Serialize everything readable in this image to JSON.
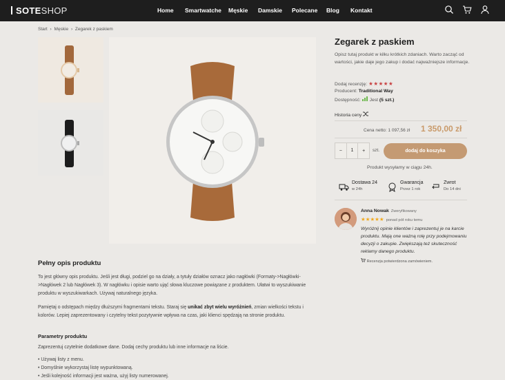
{
  "header": {
    "logo_bold": "SOTE",
    "logo_light": "SHOP",
    "nav": [
      "Home",
      "Smartwatche",
      "Męskie",
      "Damskie",
      "Polecane",
      "Blog",
      "Kontakt"
    ],
    "icons": [
      "search-icon",
      "cart-icon",
      "user-icon"
    ]
  },
  "breadcrumb": [
    "Start",
    "›",
    "Męskie",
    "›",
    "Zegarek z paskiem"
  ],
  "product": {
    "title": "Zegarek z paskiem",
    "description": "Opisz tutaj produkt w kilku krótkich zdaniach. Warto zacząć od wartości, jakie daje jego zakup i dodać najważniejsze informacje.",
    "review_label": "Dodaj recenzję:",
    "rating_stars": 5,
    "producer_label": "Producent:",
    "producer": "Traditional Way",
    "availability_label": "Dostępność:",
    "availability": "Jest",
    "stock": "(5 szt.)",
    "price_history": "Historia ceny",
    "net_price": "Cena netto: 1 097,56 zł",
    "price": "1 350,00 zł",
    "quantity": "1",
    "unit": "szt.",
    "add_to_cart": "dodaj do koszyka",
    "shipping_note": "Produkt wysyłamy w ciągu 24h."
  },
  "features": [
    {
      "title": "Dostawa 24",
      "sub": "w 24h",
      "icon": "truck-icon"
    },
    {
      "title": "Gwarancja",
      "sub": "Przez 1 rok",
      "icon": "guarantee-icon"
    },
    {
      "title": "Zwrot",
      "sub": "Do 14 dni",
      "icon": "return-icon"
    }
  ],
  "review": {
    "name": "Anna Nowak",
    "verified": "Zweryfikowany",
    "when": "ponad pół roku temu",
    "text": "Wyróżnij opinie klientów i zaprezentuj je na karcie produktu. Mają one ważną rolę przy podejmowaniu decyzji o zakupie. Zwiększają też skuteczność reklamy danego produktu.",
    "confirmed": "Recenzja potwierdzona zamówieniem."
  },
  "full_description": {
    "title": "Pełny opis produktu",
    "p1": "To jest główny opis produktu. Jeśli jest długi, podziel go na działy, a tytuły działów oznacz jako nagłówki (Formaty->Nagłówki->Nagłówek 2 lub Nagłówek 3). W nagłówku i opisie warto ująć słowa kluczowe powiązane z produktem. Ułatwi to wyszukiwanie produktu w wyszukiwarkach. Używaj naturalnego języka.",
    "p2_before": "Pamiętaj o odstępach między dłuższymi fragmentami tekstu. Staraj się ",
    "p2_bold": "unikać zbyt wielu wyróżnień",
    "p2_after": ", zmian wielkości tekstu i kolorów. Lepiej zaprezentowany i czytelny tekst pozytywnie wpływa na czas, jaki klienci spędzają na stronie produktu.",
    "params_title": "Parametry produktu",
    "params_text": "Zaprezentuj czytelnie dodatkowe dane. Dodaj cechy produktu lub inne informacje na liście.",
    "list": [
      "Używaj listy z menu.",
      "Domyślnie wykorzystaj listę wypunktowaną.",
      "Jeśli kolejność informacji jest ważna, użyj listy numerowanej."
    ]
  },
  "colors": {
    "accent": "#c49a73",
    "price": "#c99a6a",
    "rating": "#c84040",
    "review_stars": "#f0a91e",
    "header": "#1e1e1e"
  }
}
